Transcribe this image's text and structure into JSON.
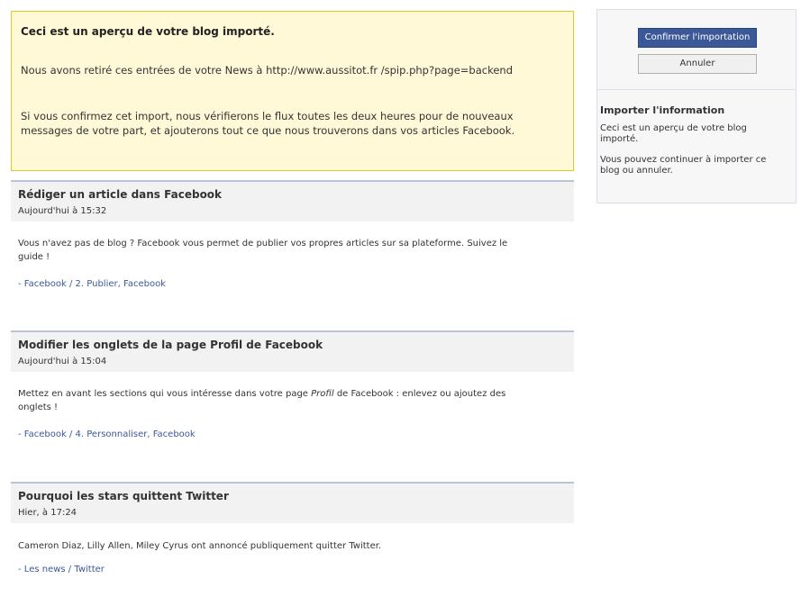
{
  "notice": {
    "title": "Ceci est un aperçu de votre blog importé.",
    "p1": "Nous avons retiré ces entrées de votre News à http://www.aussitot.fr /spip.php?page=backend",
    "p2": "Si vous confirmez cet import, nous vérifierons le flux toutes les deux heures pour de nouveaux messages de votre part, et ajouterons tout ce que nous trouverons dans vos articles Facebook."
  },
  "articles": [
    {
      "title": "Rédiger un article dans Facebook",
      "date": "Aujourd'hui à 15:32",
      "body": "Vous n'avez pas de blog ? Facebook vous permet de publier vos propres articles sur sa plateforme. Suivez le guide !",
      "link_prefix": "- ",
      "link1": "Facebook",
      "link_sep": " / ",
      "link2": "2. Publier",
      "link_comma": ", ",
      "link3": "Facebook"
    },
    {
      "title": "Modifier les onglets de la page Profil de Facebook",
      "date": "Aujourd'hui à 15:04",
      "body_before": "Mettez en avant les sections qui vous intéresse dans votre page ",
      "body_em": "Profil",
      "body_after": " de Facebook : enlevez ou ajoutez des onglets !",
      "link_prefix": "- ",
      "link1": "Facebook",
      "link_sep": " / ",
      "link2": "4. Personnaliser",
      "link_comma": ", ",
      "link3": "Facebook"
    },
    {
      "title": "Pourquoi les stars quittent Twitter",
      "date": "Hier, à 17:24",
      "body": "Cameron Diaz, Lilly Allen, Miley Cyrus ont annoncé publiquement quitter Twitter.",
      "link_prefix": "- ",
      "link1": "Les news",
      "link_sep": " / ",
      "link2": "Twitter"
    }
  ],
  "sidebar": {
    "confirm_label": "Confirmer l'importation",
    "cancel_label": "Annuler",
    "title": "Importer l'information",
    "p1": "Ceci est un aperçu de votre blog importé.",
    "p2": "Vous pouvez continuer à importer ce blog ou annuler."
  },
  "colors": {
    "notice_bg": "#fff9d7",
    "notice_border": "#e2c822",
    "link": "#3b5998",
    "button_primary": "#3b5998"
  }
}
